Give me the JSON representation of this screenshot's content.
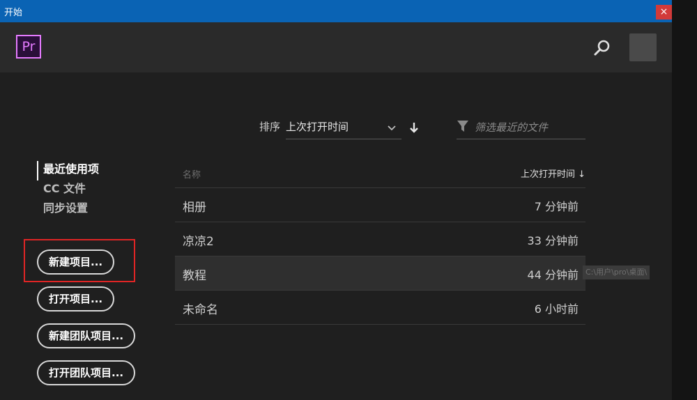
{
  "window": {
    "title": "开始",
    "close_glyph": "×"
  },
  "header": {
    "logo_text": "Pr",
    "search_icon": "search-icon",
    "avatar": "avatar"
  },
  "sort": {
    "label": "排序",
    "value": "上次打开时间"
  },
  "filter": {
    "placeholder": "筛选最近的文件"
  },
  "nav": {
    "items": [
      {
        "label": "最近使用项",
        "active": true
      },
      {
        "label": "CC 文件",
        "active": false
      },
      {
        "label": "同步设置",
        "active": false
      }
    ]
  },
  "buttons": {
    "new_project": "新建项目...",
    "open_project": "打开项目...",
    "new_team_project": "新建团队项目...",
    "open_team_project": "打开团队项目..."
  },
  "table": {
    "col_name": "名称",
    "col_time": "上次打开时间 ↓",
    "rows": [
      {
        "name": "相册",
        "time": "7 分钟前"
      },
      {
        "name": "凉凉2",
        "time": "33 分钟前"
      },
      {
        "name": "教程",
        "time": "44 分钟前"
      },
      {
        "name": "未命名",
        "time": "6 小时前"
      }
    ]
  },
  "tooltip": {
    "text": "C:\\用户\\pro\\桌面\\"
  },
  "colors": {
    "titlebar": "#0a63b4",
    "logo_accent": "#e57bff",
    "highlight": "#e02525"
  }
}
